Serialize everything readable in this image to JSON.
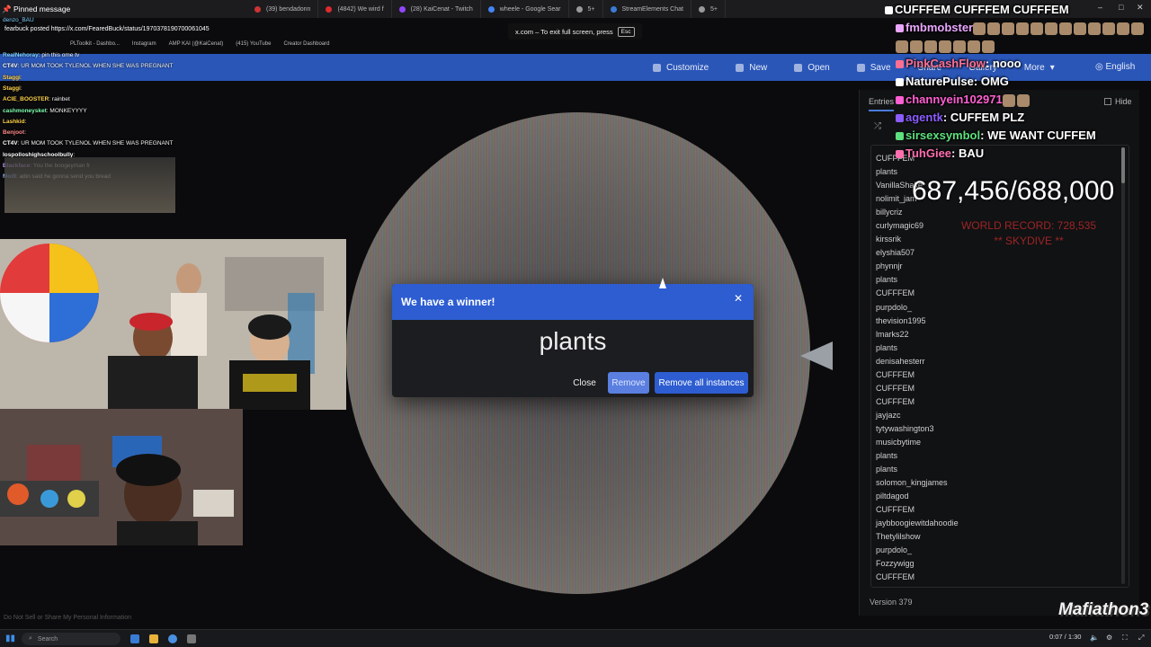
{
  "browser": {
    "tabs": [
      {
        "label": "(39) bendadonn",
        "color": "#cc3333"
      },
      {
        "label": "(4842) We wird f",
        "color": "#dd2b2b"
      },
      {
        "label": "(28) KaiCenat - Twitch",
        "color": "#9147ff"
      },
      {
        "label": "wheele - Google Sear",
        "color": "#4285f4"
      },
      {
        "label": "5+",
        "color": "#999999"
      },
      {
        "label": "StreamElements Chat",
        "color": "#3a7bd5"
      },
      {
        "label": "5+",
        "color": "#999999"
      }
    ],
    "bookmarks": [
      "PLToolkit - Dashbo...",
      "Instagram",
      "AMP KAI (@KaiCenat)",
      "(415) YouTube",
      "Creator Dashboard"
    ],
    "fullscreen_notice": "x.com – To exit full screen, press",
    "fullscreen_key": "Esc"
  },
  "app": {
    "menu": {
      "customize": "Customize",
      "new": "New",
      "open": "Open",
      "save": "Save",
      "share": "Share",
      "gallery": "Gallery",
      "more": "More",
      "language": "English"
    }
  },
  "entries_panel": {
    "tab_entries": "Entries",
    "hide_label": "Hide",
    "items": [
      "CUFFFEM",
      "plants",
      "VanillaShake",
      "nolimit_jam",
      "billycriz",
      "curlymagic69",
      "kirssrik",
      "elyshia507",
      "phynnjr",
      "plants",
      "CUFFFEM",
      "purpdolo_",
      "thevision1995",
      "lmarks22",
      "plants",
      "denisahesterr",
      "CUFFFEM",
      "CUFFFEM",
      "CUFFFEM",
      "jayjazc",
      "tytywashington3",
      "musicbytime",
      "plants",
      "plants",
      "solomon_kingjames",
      "piltdagod",
      "CUFFFEM",
      "jaybboogiewitdahoodie",
      "Thetylilshow",
      "purpdolo_",
      "Fozzywigg",
      "CUFFFEM"
    ],
    "version": "Version 379"
  },
  "modal": {
    "title": "We have a winner!",
    "winner": "plants",
    "close_label": "Close",
    "remove_label": "Remove",
    "remove_all_label": "Remove all instances"
  },
  "stream_chat_left": {
    "pinned_title": "Pinned message",
    "pinned_user": "fearbuck posted https://x.com/FearedBuck/status/1970378190700061045",
    "top_line": "denzo_BAU",
    "messages": [
      {
        "user": "RealNehoray",
        "text": "pin this ome tv"
      },
      {
        "user": "CT4V",
        "text": "UR MOM TOOK TYLENOL WHEN SHE WAS PREGNANT"
      },
      {
        "user": "Staggi",
        "text": ""
      },
      {
        "user": "Staggi",
        "text": ""
      },
      {
        "user": "ACIE_BOOSTER",
        "text": "rainbet"
      },
      {
        "user": "cashmoneysket",
        "text": "MONKEYYYY"
      },
      {
        "user": "Lashkid",
        "text": ""
      },
      {
        "user": "Benjoot",
        "text": ""
      },
      {
        "user": "CT4V",
        "text": "UR MOM TOOK TYLENOL WHEN SHE WAS PREGNANT"
      },
      {
        "user": "lospolloshighschoolbully",
        "text": ""
      },
      {
        "user": "Blackface",
        "text": "You the boogeyman fr"
      },
      {
        "user": "Moi9",
        "text": "adin said he gonna send you bread"
      }
    ]
  },
  "stream_chat_right": {
    "messages": [
      {
        "user": "CUFFFEM CUFFFEM CUFFFEM",
        "text": "",
        "color": "#ffffff"
      },
      {
        "user": "fmbmobster",
        "text": "",
        "color": "#e9a6ff"
      },
      {
        "user": "PinkCashFlow",
        "text": "nooo",
        "color": "#ff6f91"
      },
      {
        "user": "NaturePulse",
        "text": "OMG",
        "color": "#ffffff"
      },
      {
        "user": "channyein102971",
        "text": "",
        "color": "#ff5fd2"
      },
      {
        "user": "agentk",
        "text": "CUFFEM PLZ",
        "color": "#8b5cff"
      },
      {
        "user": "sirsexsymbol",
        "text": "WE WANT CUFFEM",
        "color": "#5de07d"
      },
      {
        "user": "TuhGiee",
        "text": "BAU",
        "color": "#ff6fb0"
      }
    ],
    "counter": "687,456/688,000",
    "record_line1": "WORLD RECORD: 728,535",
    "record_line2": "** SKYDIVE **"
  },
  "overlay": {
    "brand": "Mafiathon3",
    "privacy": "Do Not Sell or Share My Personal Information"
  },
  "taskbar": {
    "search_placeholder": "Search",
    "time": "0:07 / 1:30"
  }
}
